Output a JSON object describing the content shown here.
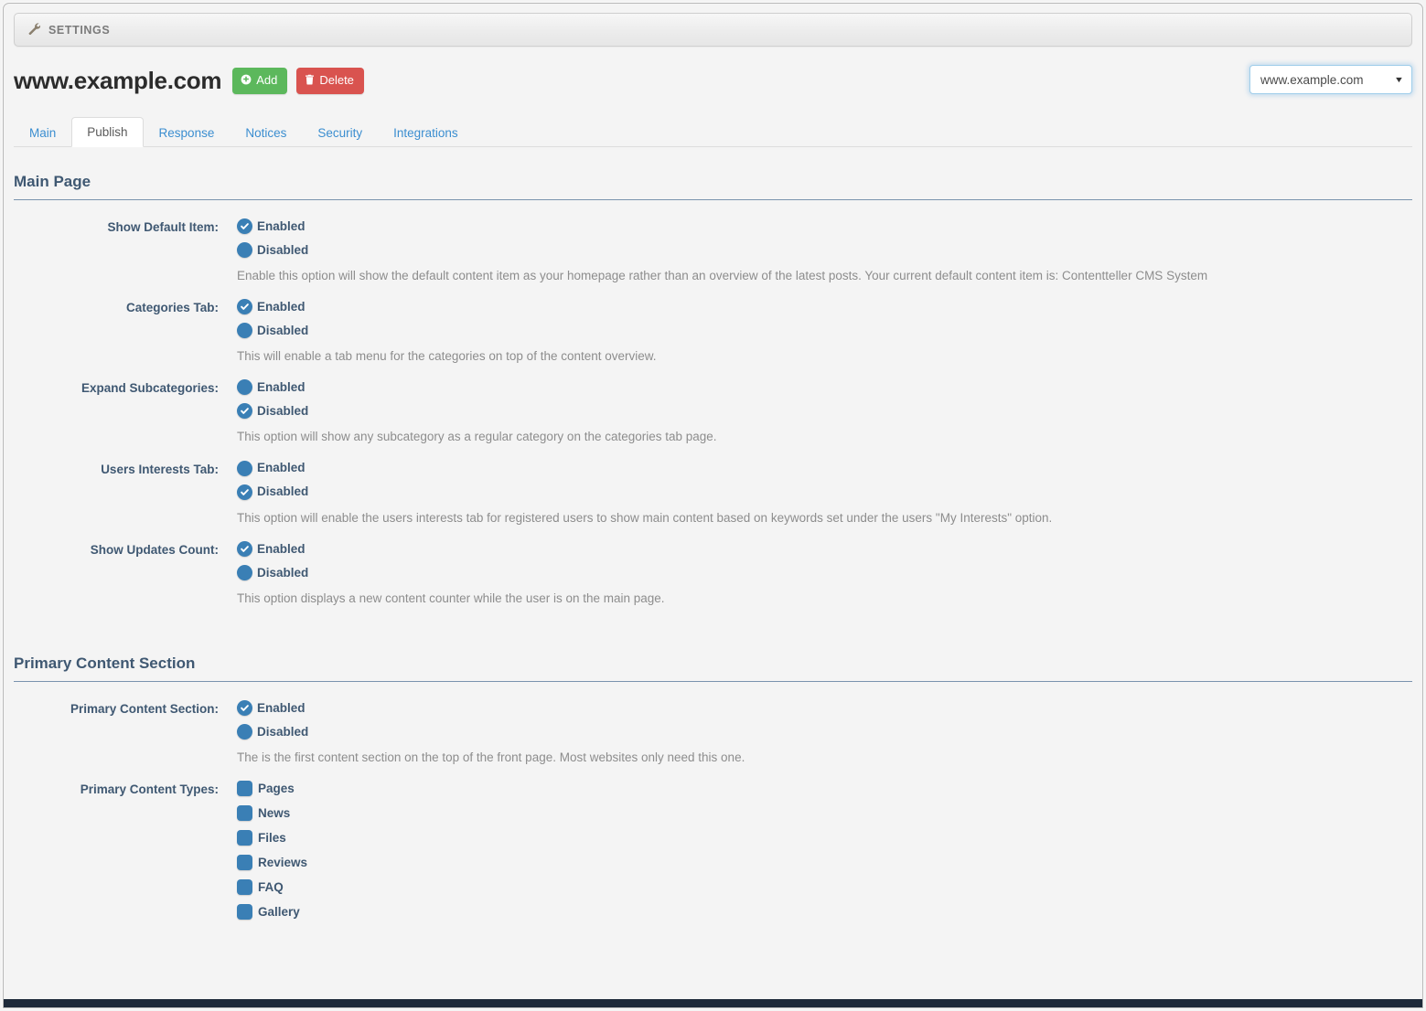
{
  "window": {
    "settings_bar_label": "SETTINGS",
    "wrench_icon": "wrench-icon"
  },
  "header": {
    "site_title": "www.example.com",
    "add_label": "Add",
    "delete_label": "Delete",
    "site_selector_value": "www.example.com"
  },
  "tabs": [
    {
      "label": "Main",
      "active": false
    },
    {
      "label": "Publish",
      "active": true
    },
    {
      "label": "Response",
      "active": false
    },
    {
      "label": "Notices",
      "active": false
    },
    {
      "label": "Security",
      "active": false
    },
    {
      "label": "Integrations",
      "active": false
    }
  ],
  "sections": [
    {
      "title": "Main Page",
      "fields": [
        {
          "label": "Show Default Item:",
          "options": [
            {
              "label": "Enabled",
              "selected": true
            },
            {
              "label": "Disabled",
              "selected": false
            }
          ],
          "description": "Enable this option will show the default content item as your homepage rather than an overview of the latest posts. Your current default content item is: Contentteller CMS System"
        },
        {
          "label": "Categories Tab:",
          "options": [
            {
              "label": "Enabled",
              "selected": true
            },
            {
              "label": "Disabled",
              "selected": false
            }
          ],
          "description": "This will enable a tab menu for the categories on top of the content overview."
        },
        {
          "label": "Expand Subcategories:",
          "options": [
            {
              "label": "Enabled",
              "selected": false
            },
            {
              "label": "Disabled",
              "selected": true
            }
          ],
          "description": "This option will show any subcategory as a regular category on the categories tab page."
        },
        {
          "label": "Users Interests Tab:",
          "options": [
            {
              "label": "Enabled",
              "selected": false
            },
            {
              "label": "Disabled",
              "selected": true
            }
          ],
          "description": "This option will enable the users interests tab for registered users to show main content based on keywords set under the users \"My Interests\" option."
        },
        {
          "label": "Show Updates Count:",
          "options": [
            {
              "label": "Enabled",
              "selected": true
            },
            {
              "label": "Disabled",
              "selected": false
            }
          ],
          "description": "This option displays a new content counter while the user is on the main page."
        }
      ]
    },
    {
      "title": "Primary Content Section",
      "fields": [
        {
          "label": "Primary Content Section:",
          "options": [
            {
              "label": "Enabled",
              "selected": true
            },
            {
              "label": "Disabled",
              "selected": false
            }
          ],
          "description": "The is the first content section on the top of the front page. Most websites only need this one."
        }
      ]
    }
  ],
  "content_types": {
    "label": "Primary Content Types:",
    "items": [
      {
        "label": "Pages",
        "checked": false
      },
      {
        "label": "News",
        "checked": false
      },
      {
        "label": "Files",
        "checked": false
      },
      {
        "label": "Reviews",
        "checked": false
      },
      {
        "label": "FAQ",
        "checked": false
      },
      {
        "label": "Gallery",
        "checked": false
      }
    ]
  },
  "colors": {
    "accent_blue": "#3a7fb5",
    "heading": "#3f5872",
    "link": "#3b8ed0",
    "add_green": "#5cb85c",
    "delete_red": "#d9534f",
    "footer_navy": "#1e2a3a"
  }
}
